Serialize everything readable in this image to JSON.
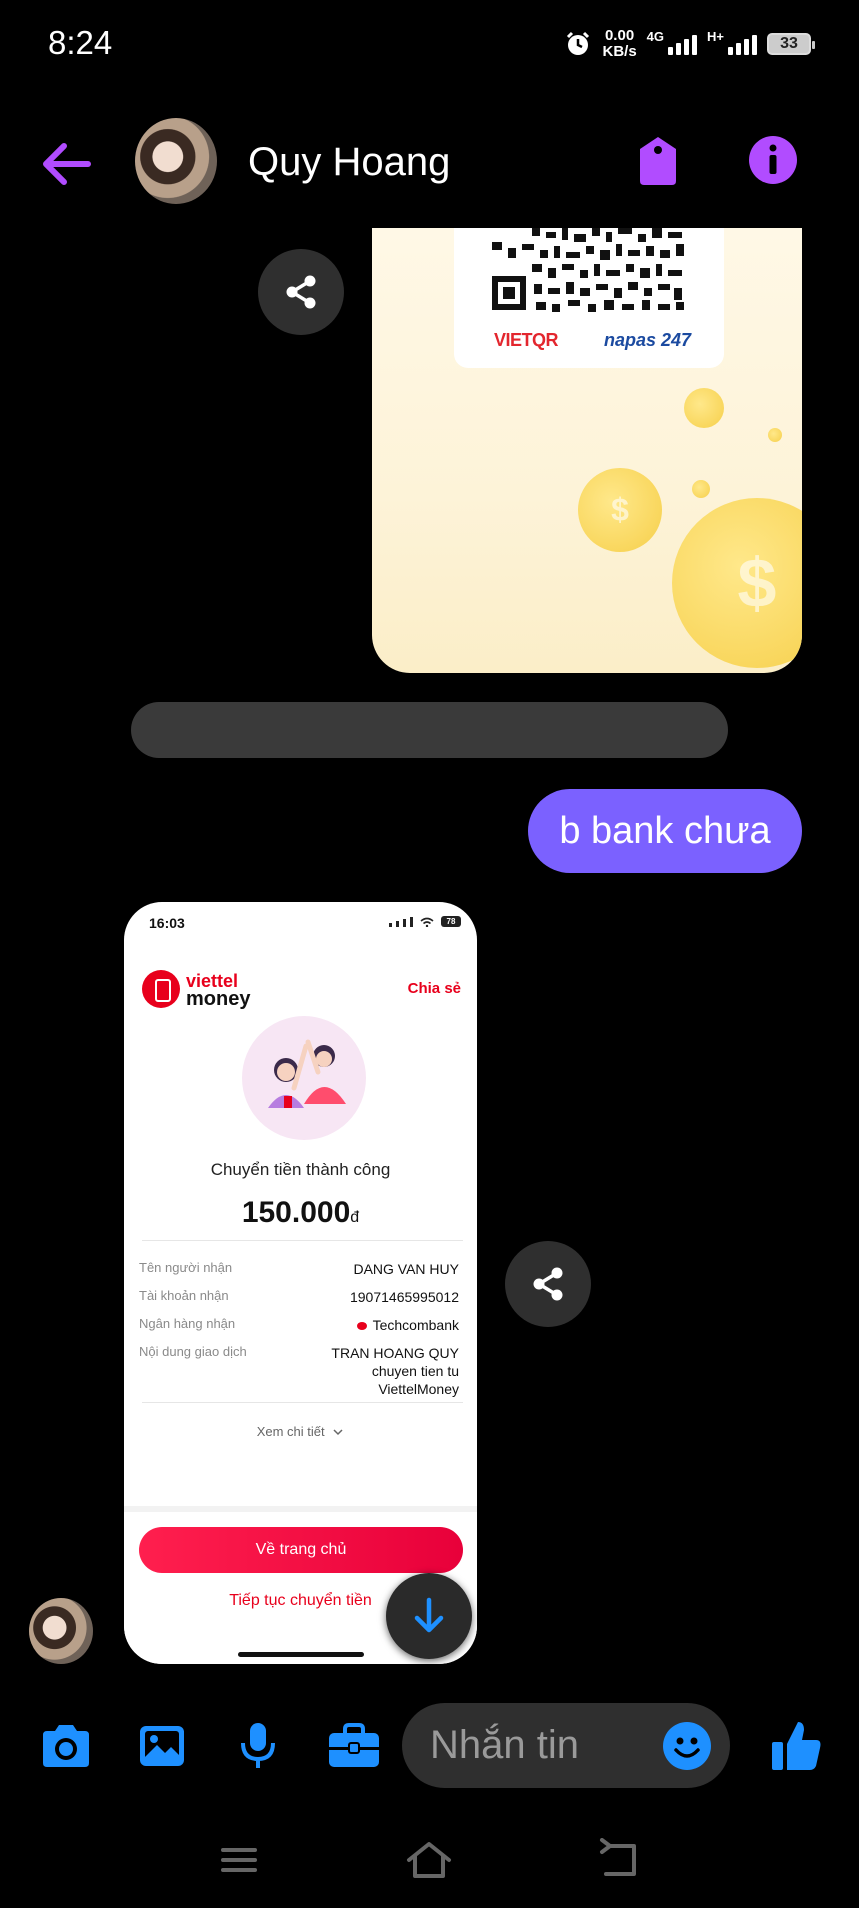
{
  "status_bar": {
    "time": "8:24",
    "net_speed_value": "0.00",
    "net_speed_unit": "KB/s",
    "network_1": "4G",
    "network_2": "H+",
    "battery": "33"
  },
  "header": {
    "contact_name": "Quy Hoang"
  },
  "messages": {
    "qr_card": {
      "logo_left": "VIETQR",
      "logo_right": "napas 247"
    },
    "outgoing_text": "b bank chưa",
    "receipt": {
      "status_time": "16:03",
      "status_battery": "78",
      "brand_line1": "viettel",
      "brand_line2": "money",
      "share_label": "Chia sẻ",
      "success_text": "Chuyển tiền thành công",
      "amount": "150.000",
      "currency": "đ",
      "rows": [
        {
          "label": "Tên người nhận",
          "value": "DANG VAN HUY"
        },
        {
          "label": "Tài khoản nhận",
          "value": "19071465995012"
        },
        {
          "label": "Ngân hàng nhận",
          "value": "Techcombank"
        },
        {
          "label": "Nội dung giao dịch",
          "value_lines": [
            "TRAN HOANG QUY",
            "chuyen tien tu",
            "ViettelMoney"
          ]
        }
      ],
      "detail_link": "Xem chi tiết",
      "home_button": "Về trang chủ",
      "continue_link": "Tiếp tục chuyển tiền"
    }
  },
  "composer": {
    "placeholder": "Nhắn tin"
  },
  "colors": {
    "accent_purple": "#a020f0",
    "bubble_purple": "#7b61ff",
    "icon_blue": "#1e90ff",
    "viettel_red": "#e8001c"
  }
}
